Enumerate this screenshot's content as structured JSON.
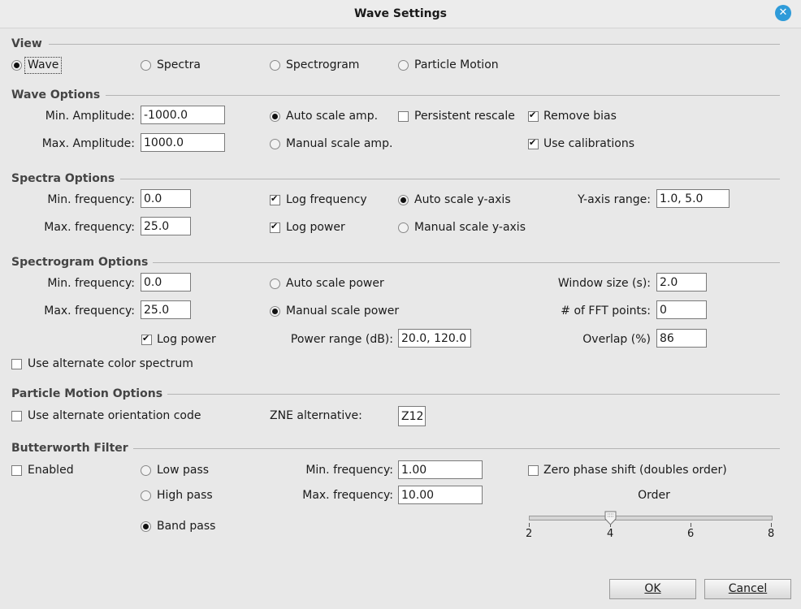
{
  "window": {
    "title": "Wave Settings"
  },
  "view": {
    "header": "View",
    "options": [
      "Wave",
      "Spectra",
      "Spectrogram",
      "Particle Motion"
    ],
    "selected": "Wave"
  },
  "wave_options": {
    "header": "Wave Options",
    "min_amp_label": "Min. Amplitude:",
    "min_amp_value": "-1000.0",
    "max_amp_label": "Max. Amplitude:",
    "max_amp_value": "1000.0",
    "auto_scale_label": "Auto scale amp.",
    "manual_scale_label": "Manual scale amp.",
    "persistent_rescale_label": "Persistent rescale",
    "remove_bias_label": "Remove bias",
    "use_calibrations_label": "Use calibrations",
    "auto_scale_selected": true,
    "persistent_rescale_checked": false,
    "remove_bias_checked": true,
    "use_calibrations_checked": true
  },
  "spectra_options": {
    "header": "Spectra Options",
    "min_freq_label": "Min. frequency:",
    "min_freq_value": "0.0",
    "max_freq_label": "Max. frequency:",
    "max_freq_value": "25.0",
    "log_frequency_label": "Log frequency",
    "log_power_label": "Log power",
    "auto_scale_label": "Auto scale y-axis",
    "manual_scale_label": "Manual scale y-axis",
    "yaxis_range_label": "Y-axis range:",
    "yaxis_range_value": "1.0, 5.0",
    "log_frequency_checked": true,
    "log_power_checked": true,
    "auto_scale_selected": true
  },
  "spectrogram_options": {
    "header": "Spectrogram Options",
    "min_freq_label": "Min. frequency:",
    "min_freq_value": "0.0",
    "max_freq_label": "Max. frequency:",
    "max_freq_value": "25.0",
    "auto_scale_power_label": "Auto scale power",
    "manual_scale_power_label": "Manual scale power",
    "log_power_label": "Log power",
    "power_range_label": "Power range (dB):",
    "power_range_value": "20.0, 120.0",
    "window_size_label": "Window size (s):",
    "window_size_value": "2.0",
    "fft_points_label": "# of FFT points:",
    "fft_points_value": "0",
    "overlap_label": "Overlap (%)",
    "overlap_value": "86",
    "alt_color_label": "Use alternate color spectrum",
    "manual_scale_selected": true,
    "log_power_checked": true,
    "alt_color_checked": false
  },
  "particle_motion_options": {
    "header": "Particle Motion Options",
    "alt_orientation_label": "Use alternate orientation code",
    "alt_orientation_checked": false,
    "zne_label": "ZNE alternative:",
    "zne_value": "Z12"
  },
  "butterworth_filter": {
    "header": "Butterworth Filter",
    "enabled_label": "Enabled",
    "enabled_checked": false,
    "low_pass_label": "Low pass",
    "high_pass_label": "High pass",
    "band_pass_label": "Band pass",
    "selected": "Band pass",
    "min_freq_label": "Min. frequency:",
    "min_freq_value": "1.00",
    "max_freq_label": "Max. frequency:",
    "max_freq_value": "10.00",
    "zero_phase_label": "Zero phase shift (doubles order)",
    "zero_phase_checked": false,
    "order_label": "Order",
    "order_value": 4,
    "order_ticks": [
      "2",
      "4",
      "6",
      "8"
    ]
  },
  "buttons": {
    "ok": "OK",
    "cancel": "Cancel"
  },
  "colors": {
    "close_button": "#2e9bd9",
    "background": "#e8e8e8"
  }
}
